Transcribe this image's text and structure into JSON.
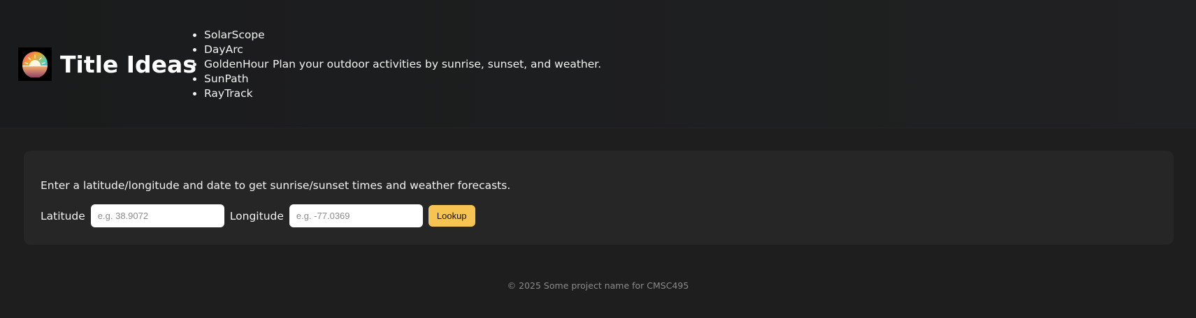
{
  "header": {
    "logo_icon": "sunrise-gradient-icon",
    "title": "Title Ideas",
    "title_options": [
      "SolarScope",
      "DayArc",
      "GoldenHour",
      "SunPath",
      "RayTrack"
    ],
    "tagline": "Plan your outdoor activities by sunrise, sunset, and weather."
  },
  "lookup": {
    "instructions": "Enter a latitude/longitude and date to get sunrise/sunset times and weather forecasts.",
    "latitude_label": "Latitude",
    "latitude_value": "",
    "latitude_placeholder": "e.g. 38.9072",
    "longitude_label": "Longitude",
    "longitude_value": "",
    "longitude_placeholder": "e.g. -77.0369",
    "button_label": "Lookup"
  },
  "footer": {
    "text": "© 2025 Some project name for CMSC495"
  },
  "colors": {
    "page_background": "#1e1e1e",
    "card_background": "#262626",
    "accent": "#f6c453",
    "muted_text": "#8a8a8a"
  }
}
